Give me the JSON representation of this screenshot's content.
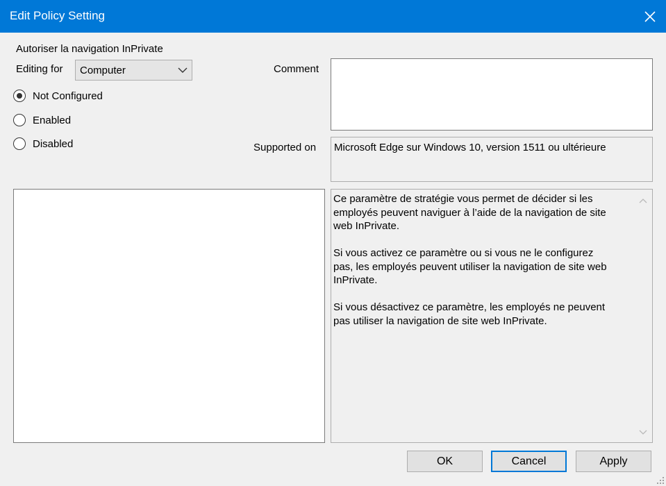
{
  "window": {
    "title": "Edit Policy Setting"
  },
  "policy": {
    "name": "Autoriser la navigation InPrivate"
  },
  "editing_for": {
    "label": "Editing for",
    "value": "Computer"
  },
  "radios": [
    {
      "label": "Not Configured",
      "checked": true
    },
    {
      "label": "Enabled",
      "checked": false
    },
    {
      "label": "Disabled",
      "checked": false
    }
  ],
  "comment": {
    "label": "Comment",
    "value": ""
  },
  "supported_on": {
    "label": "Supported on",
    "value": "Microsoft Edge sur Windows 10, version 1511 ou ultérieure"
  },
  "help_text": "Ce paramètre de stratégie vous permet de décider si les\nemployés peuvent naviguer à l’aide de la navigation de site\nweb InPrivate.\n\nSi vous activez ce paramètre ou si vous ne le configurez\npas, les employés peuvent utiliser la navigation de site web\nInPrivate.\n\nSi vous désactivez ce paramètre, les employés ne peuvent\npas utiliser la navigation de site web InPrivate.",
  "buttons": {
    "ok": "OK",
    "cancel": "Cancel",
    "apply": "Apply"
  },
  "colors": {
    "titlebar": "#0078d7",
    "background": "#f0f0f0",
    "default_button_border": "#0078d7"
  }
}
